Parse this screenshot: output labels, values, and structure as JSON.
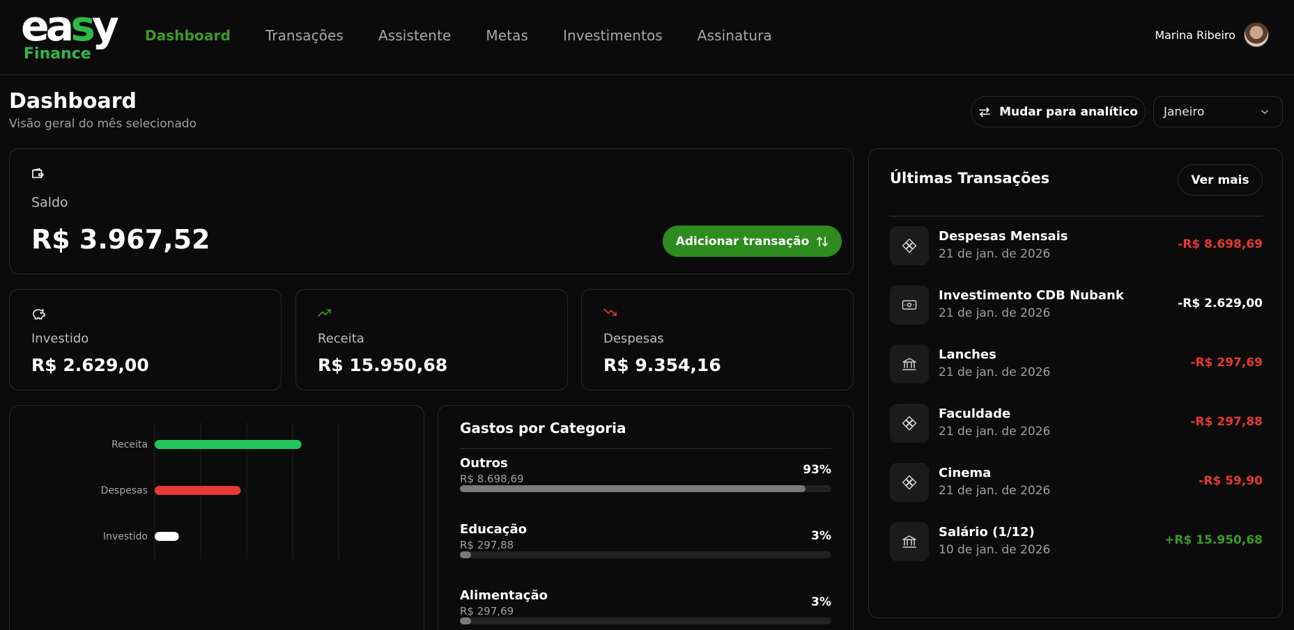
{
  "brand": {
    "name": "easy",
    "sub": "Finance"
  },
  "nav": [
    {
      "label": "Dashboard",
      "active": true
    },
    {
      "label": "Transações"
    },
    {
      "label": "Assistente"
    },
    {
      "label": "Metas"
    },
    {
      "label": "Investimentos"
    },
    {
      "label": "Assinatura"
    }
  ],
  "user": {
    "name": "Marina Ribeiro"
  },
  "header": {
    "title": "Dashboard",
    "subtitle": "Visão geral do mês selecionado",
    "switch_label": "Mudar para analítico",
    "month": "Janeiro"
  },
  "balance": {
    "label": "Saldo",
    "value": "R$ 3.967,52",
    "add_label": "Adicionar transação"
  },
  "summary": {
    "invested": {
      "label": "Investido",
      "value": "R$ 2.629,00"
    },
    "income": {
      "label": "Receita",
      "value": "R$ 15.950,68"
    },
    "expenses": {
      "label": "Despesas",
      "value": "R$ 9.354,16"
    }
  },
  "chart_data": {
    "type": "bar",
    "orientation": "horizontal",
    "categories": [
      "Receita",
      "Despesas",
      "Investido"
    ],
    "values": [
      15950.68,
      9354.16,
      2629.0
    ],
    "colors": [
      "#22c55e",
      "#e53935",
      "#ffffff"
    ],
    "grid": true,
    "xlim": [
      0,
      20000
    ]
  },
  "categories": {
    "title": "Gastos por Categoria",
    "items": [
      {
        "name": "Outros",
        "amount": "R$ 8.698,69",
        "percent": "93%",
        "fraction": 0.93
      },
      {
        "name": "Educação",
        "amount": "R$ 297,88",
        "percent": "3%",
        "fraction": 0.03
      },
      {
        "name": "Alimentação",
        "amount": "R$ 297,69",
        "percent": "3%",
        "fraction": 0.03
      }
    ]
  },
  "transactions": {
    "title": "Últimas Transações",
    "more_label": "Ver mais",
    "items": [
      {
        "name": "Despesas Mensais",
        "date": "21 de jan. de 2026",
        "value": "-R$ 8.698,69",
        "kind": "neg",
        "icon": "pix-icon"
      },
      {
        "name": "Investimento CDB Nubank",
        "date": "21 de jan. de 2026",
        "value": "-R$ 2.629,00",
        "kind": "neutral",
        "icon": "cash-icon"
      },
      {
        "name": "Lanches",
        "date": "21 de jan. de 2026",
        "value": "-R$ 297,69",
        "kind": "neg",
        "icon": "bank-icon"
      },
      {
        "name": "Faculdade",
        "date": "21 de jan. de 2026",
        "value": "-R$ 297,88",
        "kind": "neg",
        "icon": "pix-icon"
      },
      {
        "name": "Cinema",
        "date": "21 de jan. de 2026",
        "value": "-R$ 59,90",
        "kind": "neg",
        "icon": "pix-icon"
      },
      {
        "name": "Salário (1/12)",
        "date": "10 de jan. de 2026",
        "value": "+R$ 15.950,68",
        "kind": "pos",
        "icon": "bank-icon"
      }
    ]
  },
  "colors": {
    "accent": "#2e8b1e",
    "positive": "#3d9a2a",
    "negative": "#e53935",
    "background": "#0b0b0b"
  }
}
